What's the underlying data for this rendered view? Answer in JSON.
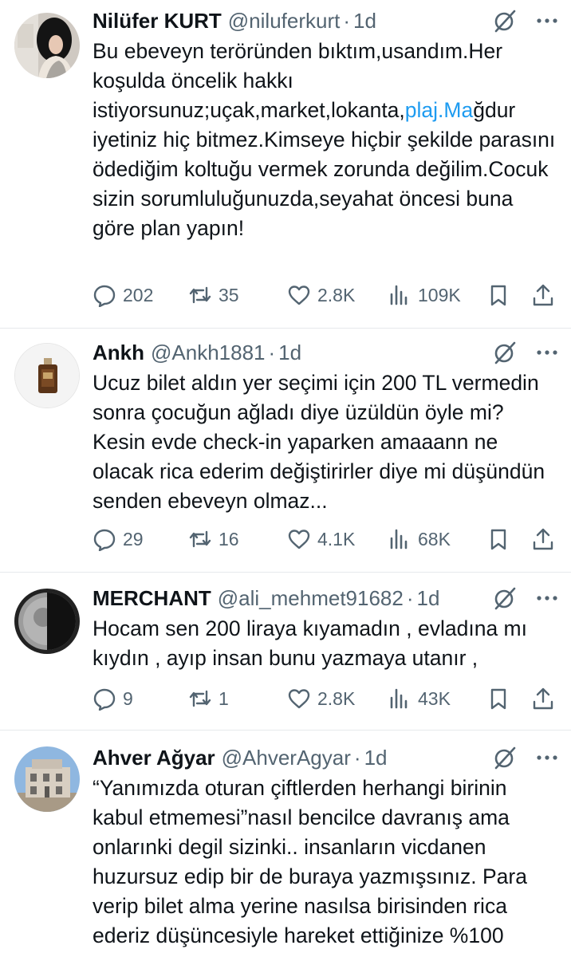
{
  "tweets": [
    {
      "name": "Nilüfer KURT",
      "handle": "@niluferkurt",
      "time": "1d",
      "text_before_link": "Bu ebeveyn teröründen bıktım,usandım.Her koşulda öncelik hakkı istiyorsunuz;uçak,market,lokanta,",
      "link_text": "plaj.Ma",
      "text_after_link": "ğdur iyetiniz hiç bitmez.Kimseye hiçbir şekilde parasını ödediğim koltuğu vermek zorunda değilim.Cocuk sizin sorumluluğunuzda,seyahat öncesi buna göre plan yapın!",
      "replies": "202",
      "retweets": "35",
      "likes": "2.8K",
      "views": "109K"
    },
    {
      "name": "Ankh",
      "handle": "@Ankh1881",
      "time": "1d",
      "text": "Ucuz bilet aldın yer seçimi için 200 TL vermedin sonra çocuğun ağladı diye üzüldün öyle mi? Kesin evde check-in yaparken amaaann ne olacak rica ederim değiştirirler diye mi düşündün senden ebeveyn olmaz...",
      "replies": "29",
      "retweets": "16",
      "likes": "4.1K",
      "views": "68K"
    },
    {
      "name": "MERCHANT",
      "handle": "@ali_mehmet91682",
      "time": "1d",
      "text": "Hocam sen 200 liraya kıyamadın , evladına mı kıydın , ayıp insan bunu yazmaya utanır ,",
      "replies": "9",
      "retweets": "1",
      "likes": "2.8K",
      "views": "43K"
    },
    {
      "name": "Ahver Ağyar",
      "handle": "@AhverAgyar",
      "time": "1d",
      "text": "“Yanımızda oturan çiftlerden herhangi birinin kabul etmemesi”nasıl bencilce davranış ama onlarınki degil sizinki.. insanların vicdanen huzursuz edip bir de buraya yazmışsınız. Para verip bilet alma yerine nasılsa birisinden rica ederiz düşüncesiyle hareket ettiğinize %100"
    }
  ],
  "separator_dot": "·",
  "colors": {
    "text": "#0f1419",
    "secondary": "#536471",
    "link": "#1d9bf0",
    "divider": "#e6e9ec"
  },
  "icons": [
    "grok-icon",
    "more-icon",
    "reply-icon",
    "retweet-icon",
    "like-icon",
    "views-icon",
    "bookmark-icon",
    "share-icon"
  ]
}
